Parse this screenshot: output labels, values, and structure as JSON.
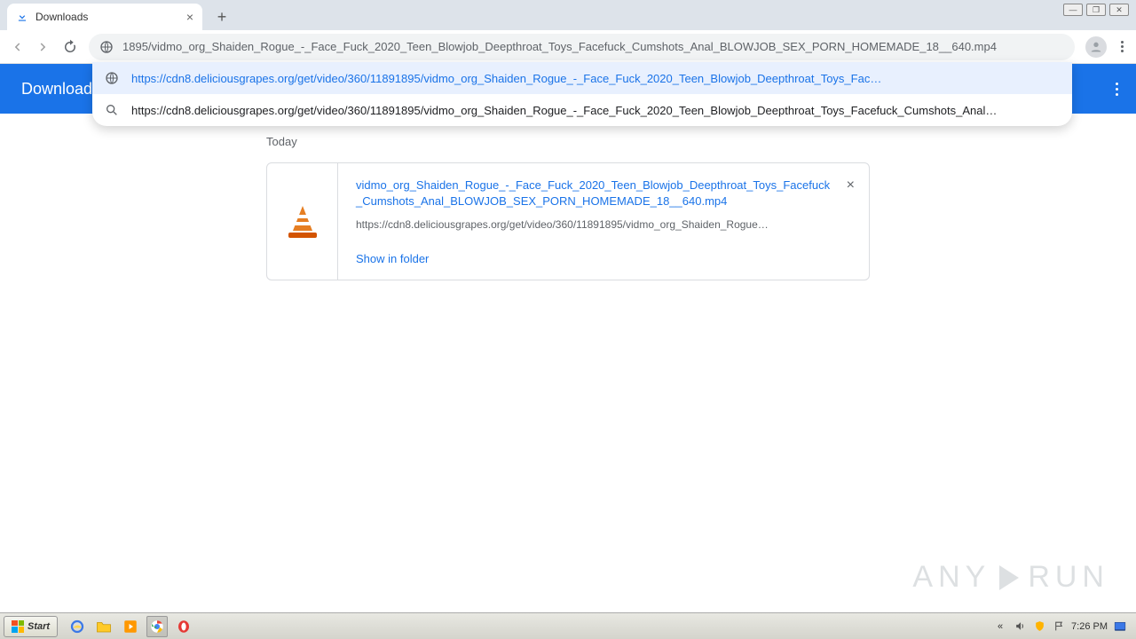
{
  "window": {
    "title": "Downloads"
  },
  "tab": {
    "title": "Downloads"
  },
  "omnibox": {
    "text": "1895/vidmo_org_Shaiden_Rogue_-_Face_Fuck_2020_Teen_Blowjob_Deepthroat_Toys_Facefuck_Cumshots_Anal_BLOWJOB_SEX_PORN_HOMEMADE_18__640.mp4"
  },
  "suggestions": [
    {
      "selected": true,
      "icon": "globe",
      "text": "https://cdn8.deliciousgrapes.org/get/video/360/11891895/vidmo_org_Shaiden_Rogue_-_Face_Fuck_2020_Teen_Blowjob_Deepthroat_Toys_Fac…"
    },
    {
      "selected": false,
      "icon": "search",
      "text": "https://cdn8.deliciousgrapes.org/get/video/360/11891895/vidmo_org_Shaiden_Rogue_-_Face_Fuck_2020_Teen_Blowjob_Deepthroat_Toys_Facefuck_Cumshots_Anal…"
    }
  ],
  "downloads": {
    "header": "Downloads",
    "section": "Today",
    "item": {
      "filename": "vidmo_org_Shaiden_Rogue_-_Face_Fuck_2020_Teen_Blowjob_Deepthroat_Toys_Facefuck_Cumshots_Anal_BLOWJOB_SEX_PORN_HOMEMADE_18__640.mp4",
      "source": "https://cdn8.deliciousgrapes.org/get/video/360/11891895/vidmo_org_Shaiden_Rogue…",
      "action": "Show in folder"
    }
  },
  "watermark": {
    "left": "ANY",
    "right": "RUN"
  },
  "taskbar": {
    "start": "Start",
    "clock": "7:26 PM"
  }
}
